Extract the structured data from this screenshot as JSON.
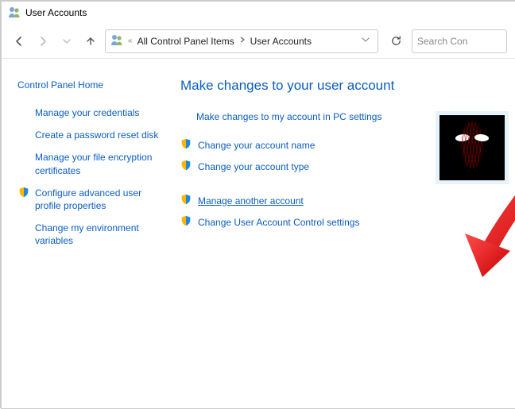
{
  "window": {
    "title": "User Accounts"
  },
  "toolbar": {
    "breadcrumb": [
      {
        "label": "All Control Panel Items"
      },
      {
        "label": "User Accounts"
      }
    ],
    "search_placeholder": "Search Con"
  },
  "sidebar": {
    "heading": "Control Panel Home",
    "items": [
      {
        "label": "Manage your credentials",
        "shield": false
      },
      {
        "label": "Create a password reset disk",
        "shield": false
      },
      {
        "label": "Manage your file encryption certificates",
        "shield": false
      },
      {
        "label": "Configure advanced user profile properties",
        "shield": true
      },
      {
        "label": "Change my environment variables",
        "shield": false
      }
    ]
  },
  "main": {
    "heading": "Make changes to your user account",
    "pc_settings_link": "Make changes to my account in PC settings",
    "actions_group1": [
      {
        "label": "Change your account name",
        "shield": true
      },
      {
        "label": "Change your account type",
        "shield": true
      }
    ],
    "actions_group2": [
      {
        "label": "Manage another account",
        "shield": true,
        "highlight": true
      },
      {
        "label": "Change User Account Control settings",
        "shield": true
      }
    ]
  }
}
